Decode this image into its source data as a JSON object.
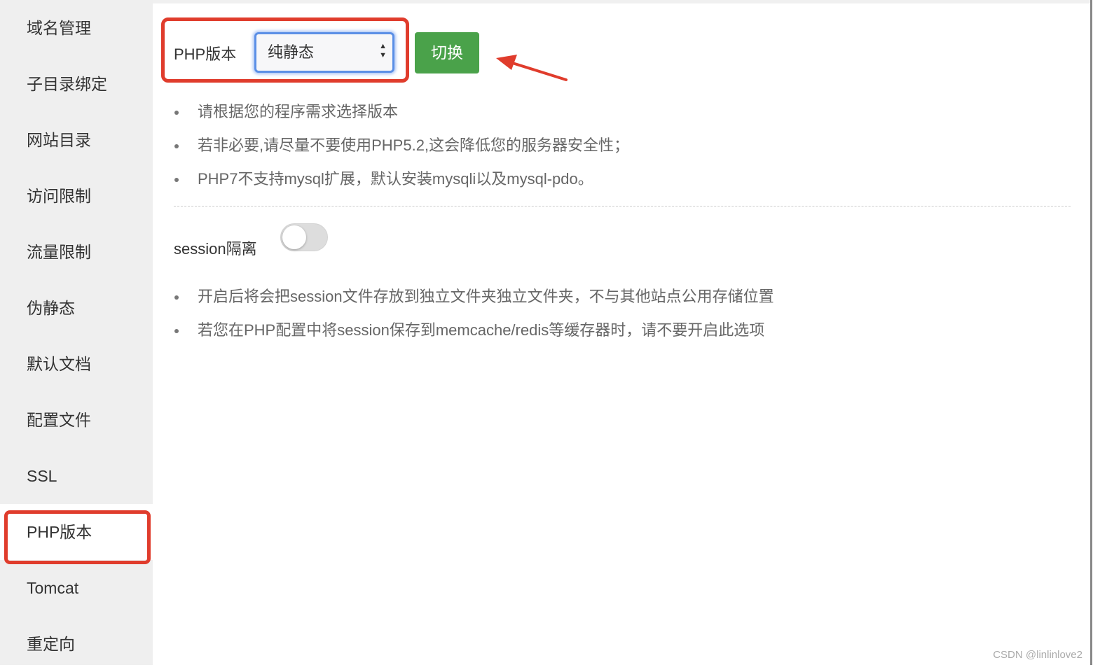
{
  "sidebar": {
    "items": [
      "域名管理",
      "子目录绑定",
      "网站目录",
      "访问限制",
      "流量限制",
      "伪静态",
      "默认文档",
      "配置文件",
      "SSL",
      "PHP版本",
      "Tomcat",
      "重定向"
    ],
    "active": "PHP版本"
  },
  "php": {
    "label": "PHP版本",
    "selected": "纯静态",
    "switch_label": "切换"
  },
  "tips1": [
    "请根据您的程序需求选择版本",
    "若非必要,请尽量不要使用PHP5.2,这会降低您的服务器安全性；",
    "PHP7不支持mysql扩展，默认安装mysqli以及mysql-pdo。"
  ],
  "session": {
    "label": "session隔离",
    "enabled": false
  },
  "tips2": [
    "开启后将会把session文件存放到独立文件夹独立文件夹，不与其他站点公用存储位置",
    "若您在PHP配置中将session保存到memcache/redis等缓存器时，请不要开启此选项"
  ],
  "watermark": "CSDN @linlinlove2",
  "colors": {
    "highlight": "#e03c2c",
    "button": "#4aa24a",
    "focus": "#5b8fe6"
  }
}
